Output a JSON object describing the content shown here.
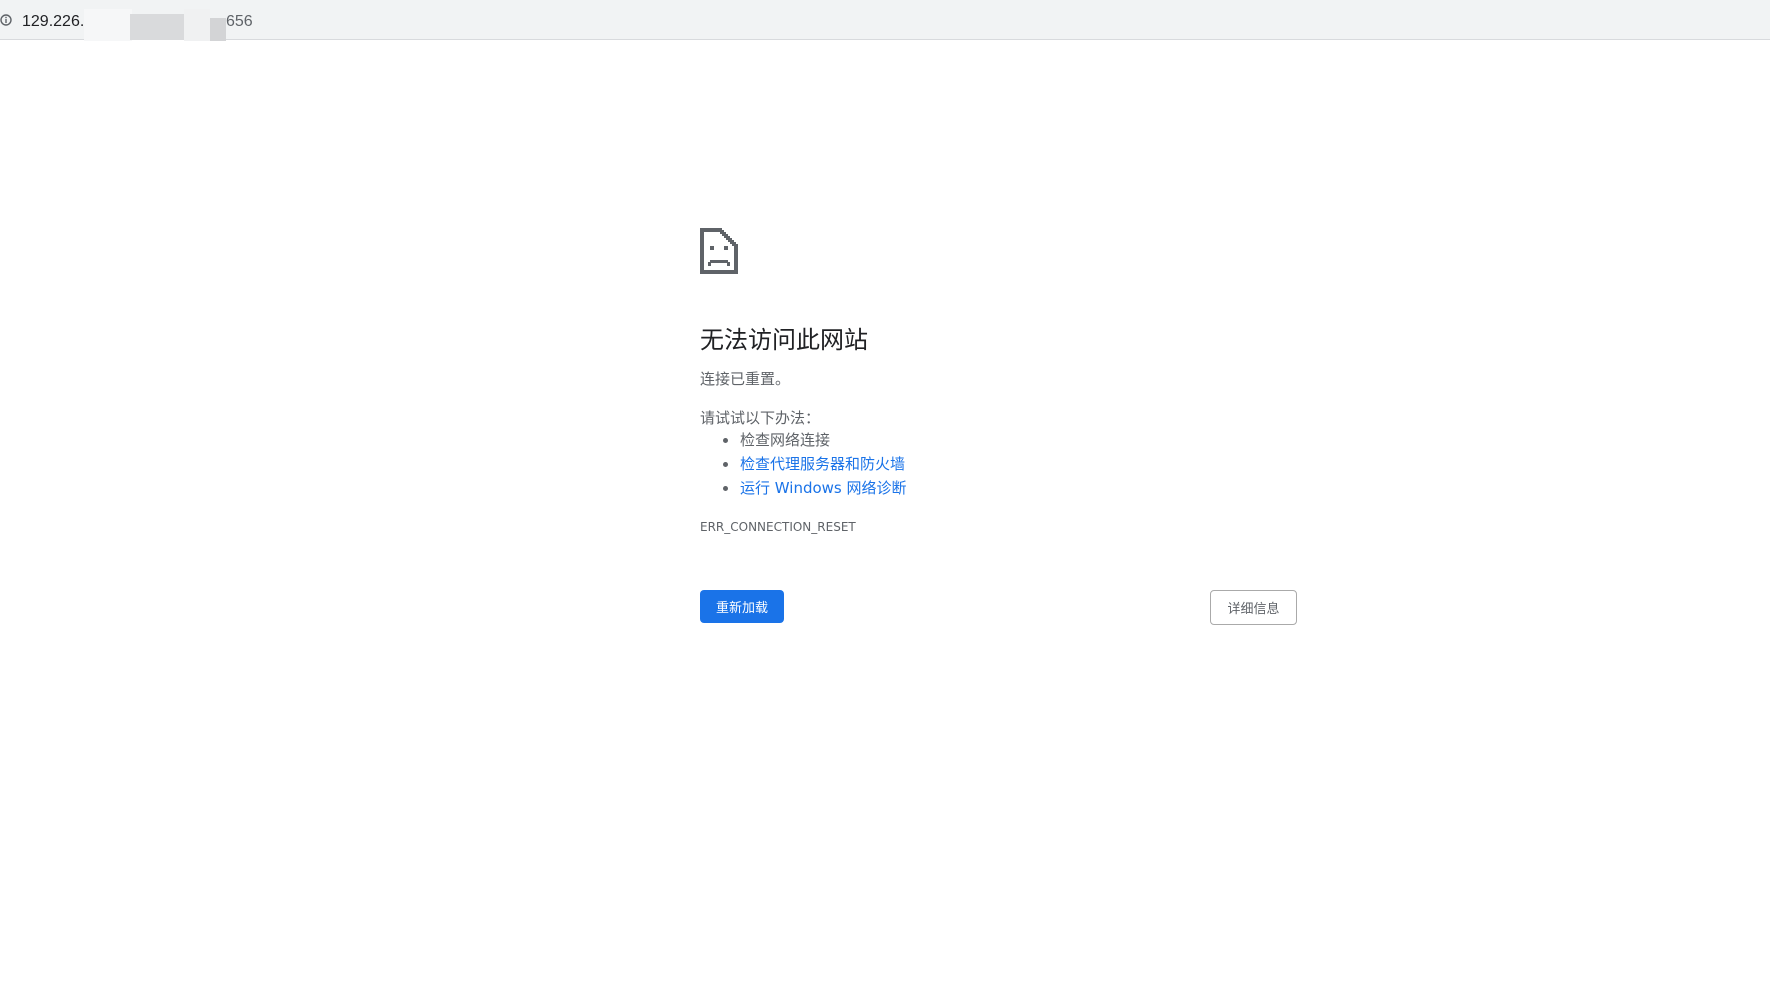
{
  "address_bar": {
    "url_prefix": "129.226.",
    "url_suffix": "656",
    "info_icon": "info-circle-icon"
  },
  "error_page": {
    "icon": "sad-page-icon",
    "title": "无法访问此网站",
    "subtitle": "连接已重置。",
    "suggestions_heading": "请试试以下办法：",
    "suggestions": [
      {
        "label": "检查网络连接",
        "is_link": false
      },
      {
        "label": "检查代理服务器和防火墙",
        "is_link": true
      },
      {
        "label": "运行 Windows 网络诊断",
        "is_link": true
      }
    ],
    "error_code": "ERR_CONNECTION_RESET",
    "reload_label": "重新加载",
    "details_label": "详细信息"
  },
  "colors": {
    "link": "#1a73e8",
    "primary_button": "#1a73e8",
    "text_primary": "#202124",
    "text_secondary": "#5f6368"
  }
}
